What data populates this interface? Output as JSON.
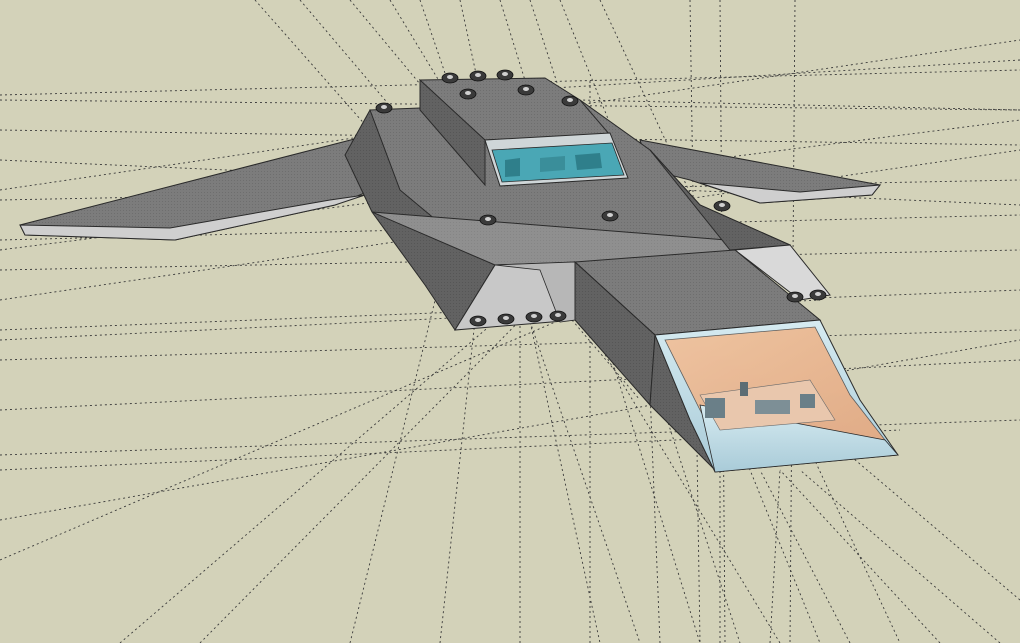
{
  "viewport": {
    "background_color": "#d3d2b9",
    "guide_line_color": "#3a3a3a",
    "hull_color": "#7c7c7c",
    "hull_dark_color": "#5f5f5f",
    "hull_light_color": "#9a9a9a",
    "glass_blue_color": "#bcdce8",
    "glass_orange_color": "#e8b48e",
    "cockpit_teal_color": "#4aa7b5"
  },
  "model": {
    "parts": [
      "left-wing",
      "right-wing",
      "main-hull",
      "upper-deck",
      "top-canopy",
      "forward-module",
      "cockpit-glass",
      "left-intake",
      "right-intake",
      "thrusters"
    ]
  }
}
